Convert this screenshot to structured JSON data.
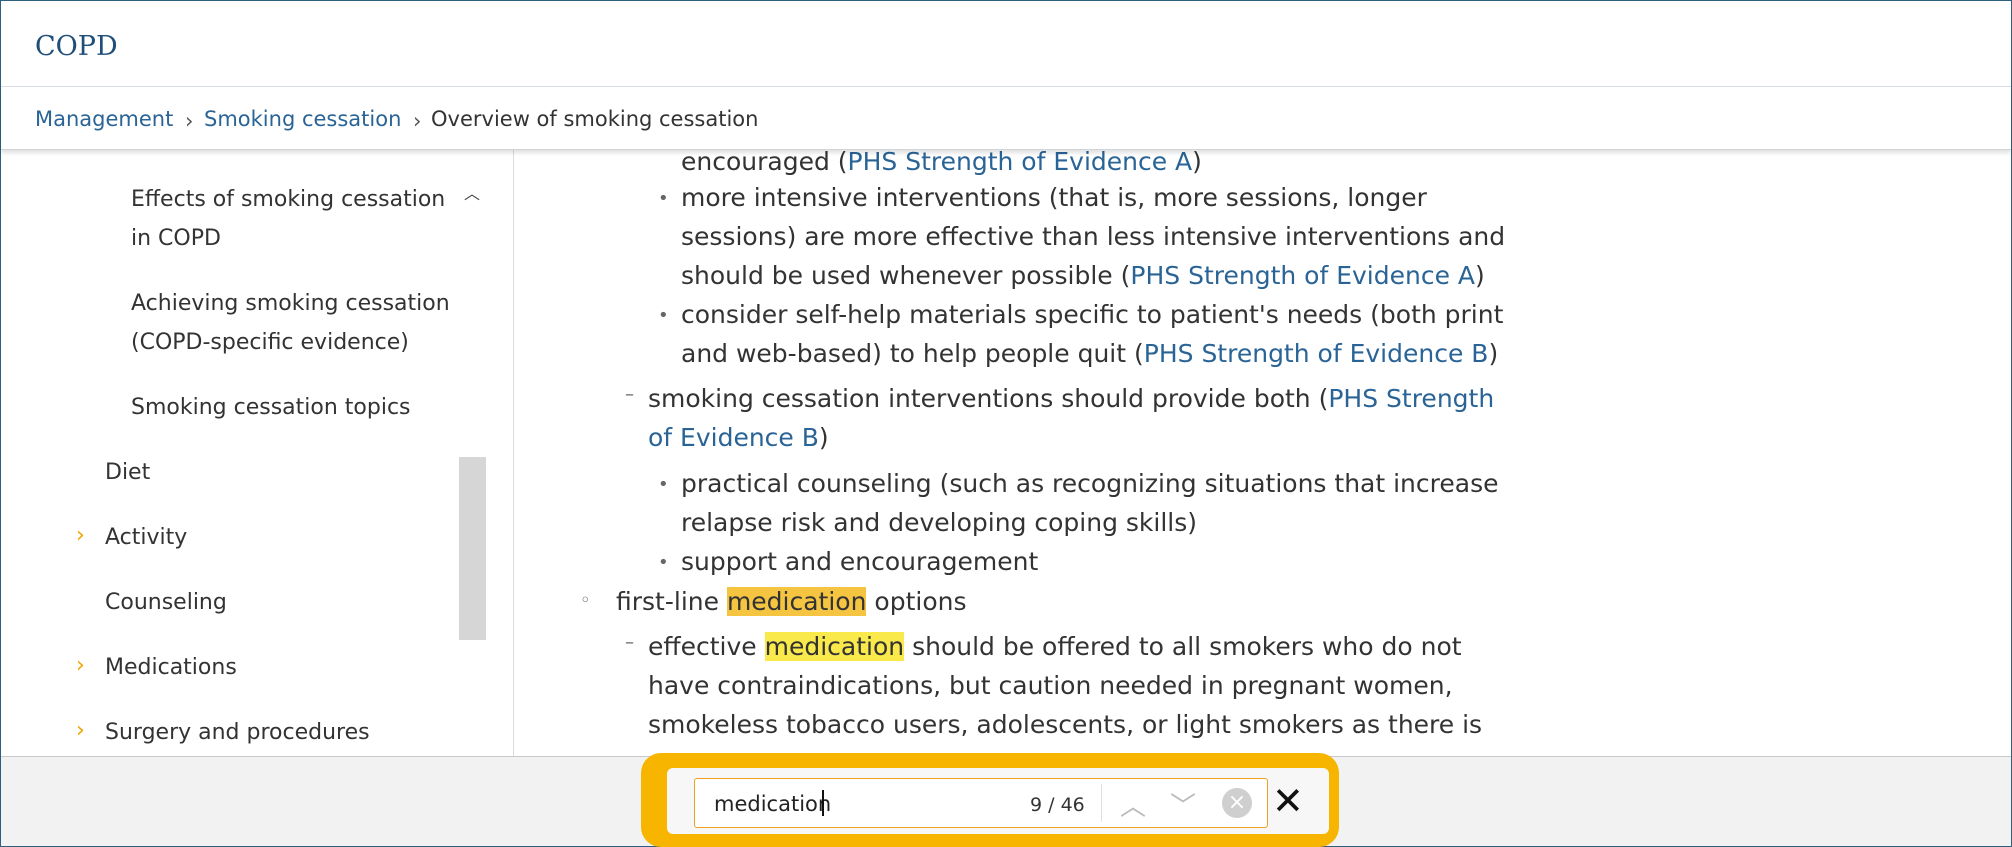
{
  "header": {
    "title": "COPD"
  },
  "breadcrumb": {
    "items": [
      "Management",
      "Smoking cessation",
      "Overview of smoking cessation"
    ],
    "separator": "›"
  },
  "sidebar": {
    "items": [
      {
        "label": "Effects of smoking cessation",
        "label2": "in COPD"
      },
      {
        "label": "Achieving smoking cessation",
        "label2": "(COPD-specific evidence)"
      },
      {
        "label": "Smoking cessation topics"
      },
      {
        "label": "Diet"
      },
      {
        "label": "Activity",
        "expandable": true
      },
      {
        "label": "Counseling"
      },
      {
        "label": "Medications",
        "expandable": true
      },
      {
        "label": "Surgery and procedures",
        "expandable": true
      }
    ],
    "scroll_up_icon": "chevron-up-icon"
  },
  "content": {
    "l1_text": "encouraged (",
    "l1_link": "PHS Strength of Evidence A",
    "l1_end": ")",
    "b1_a": "more intensive interventions (that is, more sessions, longer",
    "b1_b": "sessions) are more effective than less intensive interventions and",
    "b1_c_text": "should be used whenever possible (",
    "b1_c_link": "PHS Strength of Evidence A",
    "b1_c_end": ")",
    "b2_a": "consider self-help materials specific to patient's needs (both print",
    "b2_b_text": "and web-based) to help people quit (",
    "b2_b_link": "PHS Strength of Evidence B",
    "b2_b_end": ")",
    "d1_a_text": "smoking cessation interventions should provide both (",
    "d1_a_link": "PHS Strength",
    "d1_b_link": "of Evidence B",
    "d1_b_end": ")",
    "b3_a": "practical counseling (such as recognizing situations that increase",
    "b3_b": "relapse risk and developing coping skills)",
    "b4": "support and encouragement",
    "c1_pre": "first-line ",
    "c1_hl": "medication",
    "c1_post": " options",
    "d2_pre": "effective ",
    "d2_hl": "medication",
    "d2_post": " should be offered to all smokers who do not",
    "d2_b": "have contraindications, but caution needed in pregnant women,",
    "d2_c": "smokeless tobacco users, adolescents, or light smokers as there is"
  },
  "findbar": {
    "query": "medication",
    "count": "9 / 46"
  },
  "colors": {
    "link": "#2a6496",
    "accent": "#f7b500",
    "highlight_current": "#f5c542",
    "highlight": "#f9e94a"
  }
}
